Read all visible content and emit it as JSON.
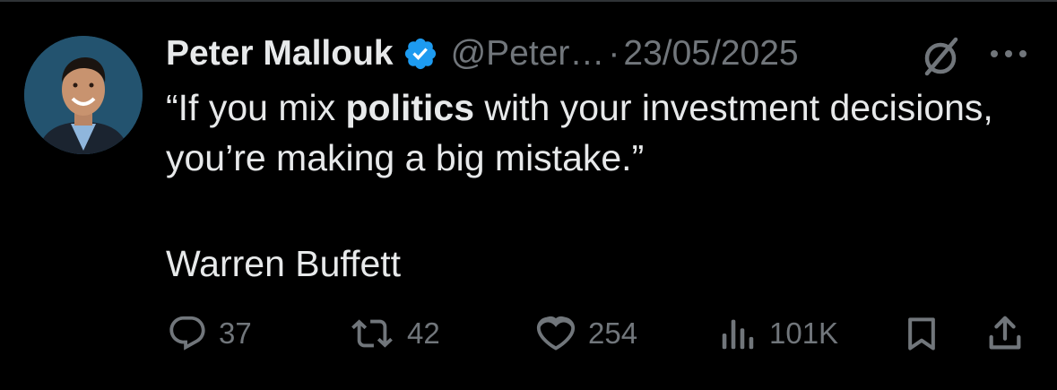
{
  "tweet": {
    "author_name": "Peter Mallouk",
    "handle": "@Peter…",
    "separator": "·",
    "date": "23/05/2025",
    "text_before": "“If you mix ",
    "text_bold": "politics",
    "text_after": " with your investment decisions, you’re making a big mistake.”",
    "attribution": "Warren Buffett"
  },
  "actions": {
    "replies": "37",
    "reposts": "42",
    "likes": "254",
    "views": "101K"
  },
  "icons": {
    "verified": "verified-badge-icon",
    "grok": "grok-icon",
    "more": "more-icon",
    "reply": "reply-icon",
    "repost": "repost-icon",
    "like": "heart-icon",
    "views": "views-icon",
    "bookmark": "bookmark-icon",
    "share": "share-icon"
  },
  "colors": {
    "background": "#000000",
    "primary_text": "#e7e9ea",
    "secondary_text": "#71767b",
    "verified_blue": "#1d9bf0"
  }
}
